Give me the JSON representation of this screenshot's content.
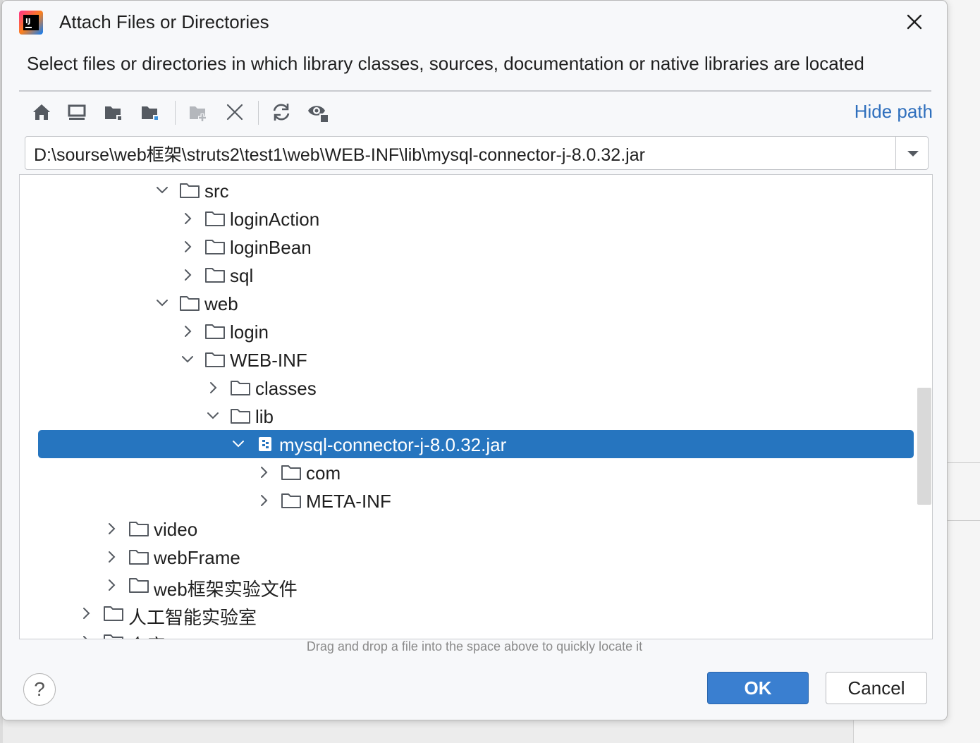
{
  "dialog": {
    "title": "Attach Files or Directories",
    "description": "Select files or directories in which library classes, sources, documentation or native libraries are located",
    "close_icon": "close-icon"
  },
  "toolbar": {
    "buttons": [
      {
        "name": "home-icon",
        "tooltip": "Home"
      },
      {
        "name": "desktop-icon",
        "tooltip": "Desktop"
      },
      {
        "name": "project-folder-icon",
        "tooltip": "Project directory"
      },
      {
        "name": "module-folder-icon",
        "tooltip": "Module directory"
      },
      {
        "name": "new-folder-icon",
        "tooltip": "New folder"
      },
      {
        "name": "delete-icon",
        "tooltip": "Delete"
      },
      {
        "name": "refresh-icon",
        "tooltip": "Refresh"
      },
      {
        "name": "show-hidden-icon",
        "tooltip": "Show hidden files"
      }
    ],
    "hide_path_label": "Hide path"
  },
  "path": {
    "value": "D:\\sourse\\web框架\\struts2\\test1\\web\\WEB-INF\\lib\\mysql-connector-j-8.0.32.jar"
  },
  "tree": {
    "nodes": [
      {
        "label": "src",
        "depth": 5,
        "expanded": true,
        "type": "folder"
      },
      {
        "label": "loginAction",
        "depth": 6,
        "expanded": false,
        "type": "folder"
      },
      {
        "label": "loginBean",
        "depth": 6,
        "expanded": false,
        "type": "folder"
      },
      {
        "label": "sql",
        "depth": 6,
        "expanded": false,
        "type": "folder"
      },
      {
        "label": "web",
        "depth": 5,
        "expanded": true,
        "type": "folder"
      },
      {
        "label": "login",
        "depth": 6,
        "expanded": false,
        "type": "folder"
      },
      {
        "label": "WEB-INF",
        "depth": 6,
        "expanded": true,
        "type": "folder"
      },
      {
        "label": "classes",
        "depth": 7,
        "expanded": false,
        "type": "folder"
      },
      {
        "label": "lib",
        "depth": 7,
        "expanded": true,
        "type": "folder"
      },
      {
        "label": "mysql-connector-j-8.0.32.jar",
        "depth": 8,
        "expanded": true,
        "type": "jar",
        "selected": true
      },
      {
        "label": "com",
        "depth": 9,
        "expanded": false,
        "type": "folder"
      },
      {
        "label": "META-INF",
        "depth": 9,
        "expanded": false,
        "type": "folder"
      },
      {
        "label": "video",
        "depth": 3,
        "expanded": false,
        "type": "folder"
      },
      {
        "label": "webFrame",
        "depth": 3,
        "expanded": false,
        "type": "folder"
      },
      {
        "label": "web框架实验文件",
        "depth": 3,
        "expanded": false,
        "type": "folder"
      },
      {
        "label": "人工智能实验室",
        "depth": 2,
        "expanded": false,
        "type": "folder"
      },
      {
        "label": "会度",
        "depth": 2,
        "expanded": false,
        "type": "folder"
      }
    ]
  },
  "hint": "Drag and drop a file into the space above to quickly locate it",
  "buttons": {
    "help_label": "?",
    "ok_label": "OK",
    "cancel_label": "Cancel"
  },
  "colors": {
    "selection": "#2675bf",
    "link": "#2f6fbd",
    "ok_button": "#3a7fd0"
  }
}
